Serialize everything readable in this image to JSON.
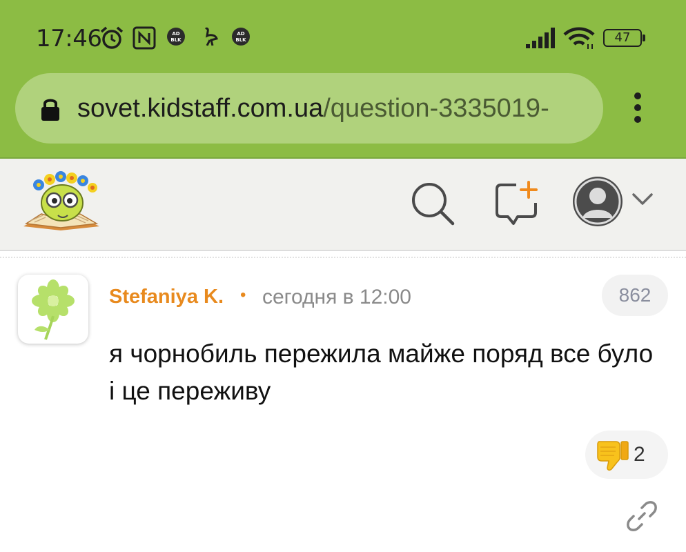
{
  "status_bar": {
    "time": "17:46",
    "battery": "47",
    "ad_badge_text": "AD BLOCKER"
  },
  "browser": {
    "url_domain": "sovet.kidstaff.com.ua",
    "url_path": "/question-3335019-"
  },
  "site_header": {
    "icons": [
      "search-icon",
      "new-question-icon",
      "user-avatar-icon",
      "chevron-down-icon"
    ]
  },
  "comment": {
    "author": "Stefaniya K.",
    "dot": "•",
    "time": "сегодня в 12:00",
    "number": "862",
    "text": "я чорнобиль пережила майже поряд все було і це переживу",
    "dislike_count": "2"
  },
  "colors": {
    "chrome_green": "#8cbc44",
    "url_bar": "#b0d27c",
    "author_orange": "#e88a1e",
    "accent_orange": "#f08a1c"
  }
}
